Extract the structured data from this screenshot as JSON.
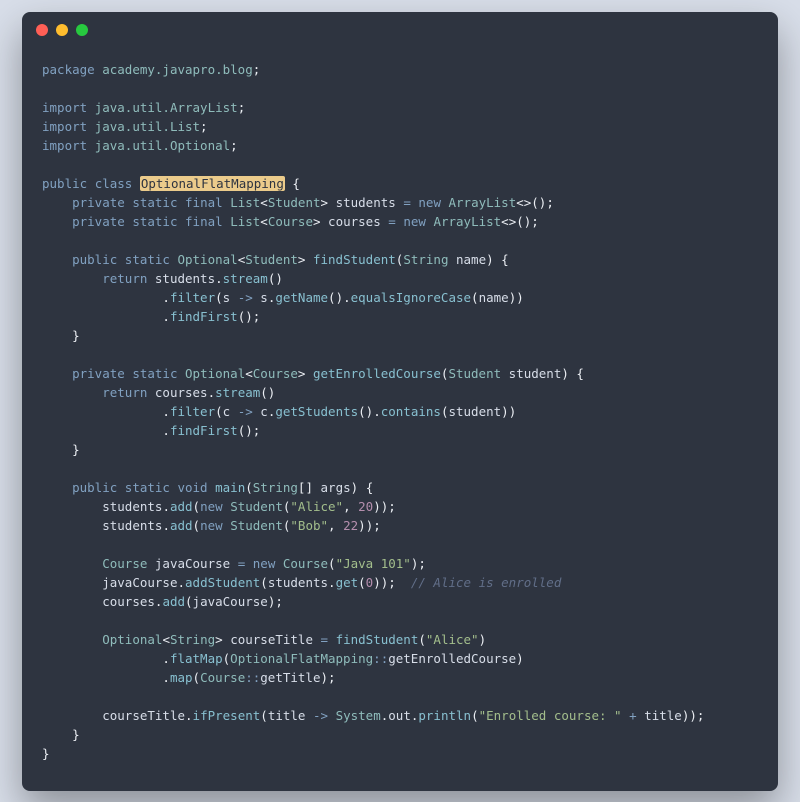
{
  "window": {
    "traffic_lights": [
      "red",
      "yellow",
      "green"
    ]
  },
  "code": {
    "package_kw": "package",
    "package_path": "academy.javapro.blog",
    "import_kw": "import",
    "imports": [
      "java.util.ArrayList",
      "java.util.List",
      "java.util.Optional"
    ],
    "public_kw": "public",
    "private_kw": "private",
    "static_kw": "static",
    "final_kw": "final",
    "class_kw": "class",
    "return_kw": "return",
    "new_kw": "new",
    "void_kw": "void",
    "class_name": "OptionalFlatMapping",
    "type_list": "List",
    "type_student": "Student",
    "type_course": "Course",
    "type_optional": "Optional",
    "type_string": "String",
    "type_arraylist": "ArrayList",
    "field_students": "students",
    "field_courses": "courses",
    "m_findStudent": "findStudent",
    "m_getEnrolledCourse": "getEnrolledCourse",
    "m_main": "main",
    "m_stream": "stream",
    "m_filter": "filter",
    "m_getName": "getName",
    "m_equalsIgnoreCase": "equalsIgnoreCase",
    "m_findFirst": "findFirst",
    "m_getStudents": "getStudents",
    "m_contains": "contains",
    "m_add": "add",
    "m_get": "get",
    "m_addStudent": "addStudent",
    "m_flatMap": "flatMap",
    "m_map": "map",
    "m_getTitle": "getTitle",
    "m_ifPresent": "ifPresent",
    "m_println": "println",
    "p_name": "name",
    "p_student": "student",
    "p_args": "args",
    "p_s": "s",
    "p_c": "c",
    "p_title": "title",
    "v_javaCourse": "javaCourse",
    "v_courseTitle": "courseTitle",
    "v_System": "System",
    "v_out": "out",
    "str_alice": "\"Alice\"",
    "str_bob": "\"Bob\"",
    "str_java101": "\"Java 101\"",
    "str_enrolled": "\"Enrolled course: \"",
    "num_20": "20",
    "num_22": "22",
    "num_0": "0",
    "comment_alice": "// Alice is enrolled"
  }
}
